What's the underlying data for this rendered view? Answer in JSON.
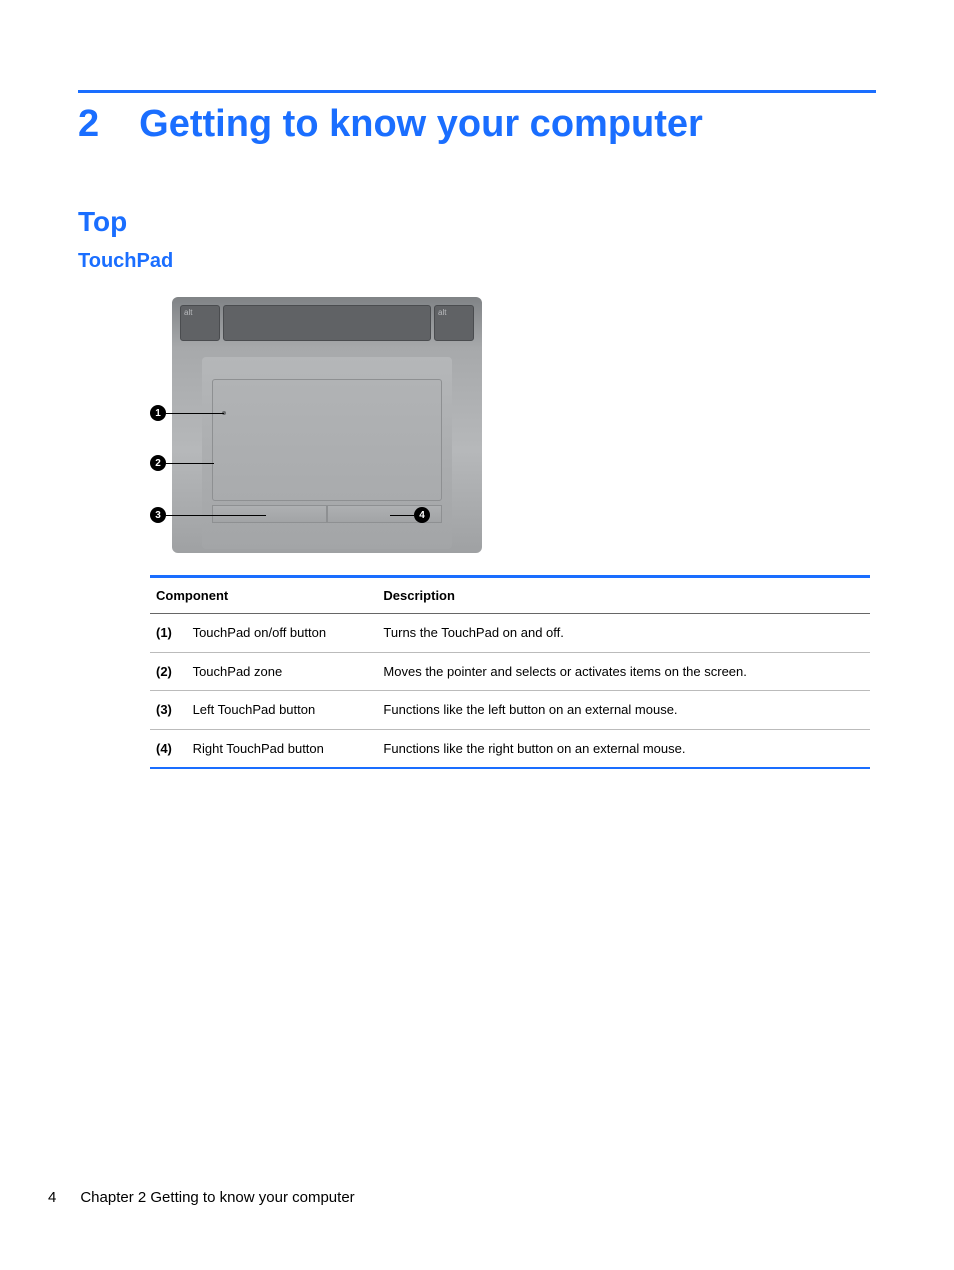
{
  "chapter": {
    "number": "2",
    "title": "Getting to know your computer"
  },
  "section": {
    "h2": "Top",
    "h3": "TouchPad"
  },
  "callouts": {
    "c1": "1",
    "c2": "2",
    "c3": "3",
    "c4": "4"
  },
  "table": {
    "headers": {
      "component": "Component",
      "description": "Description"
    },
    "rows": [
      {
        "id": "(1)",
        "name": "TouchPad on/off button",
        "desc": "Turns the TouchPad on and off."
      },
      {
        "id": "(2)",
        "name": "TouchPad zone",
        "desc": "Moves the pointer and selects or activates items on the screen."
      },
      {
        "id": "(3)",
        "name": "Left TouchPad button",
        "desc": "Functions like the left button on an external mouse."
      },
      {
        "id": "(4)",
        "name": "Right TouchPad button",
        "desc": "Functions like the right button on an external mouse."
      }
    ]
  },
  "footer": {
    "page": "4",
    "text": "Chapter 2   Getting to know your computer"
  }
}
